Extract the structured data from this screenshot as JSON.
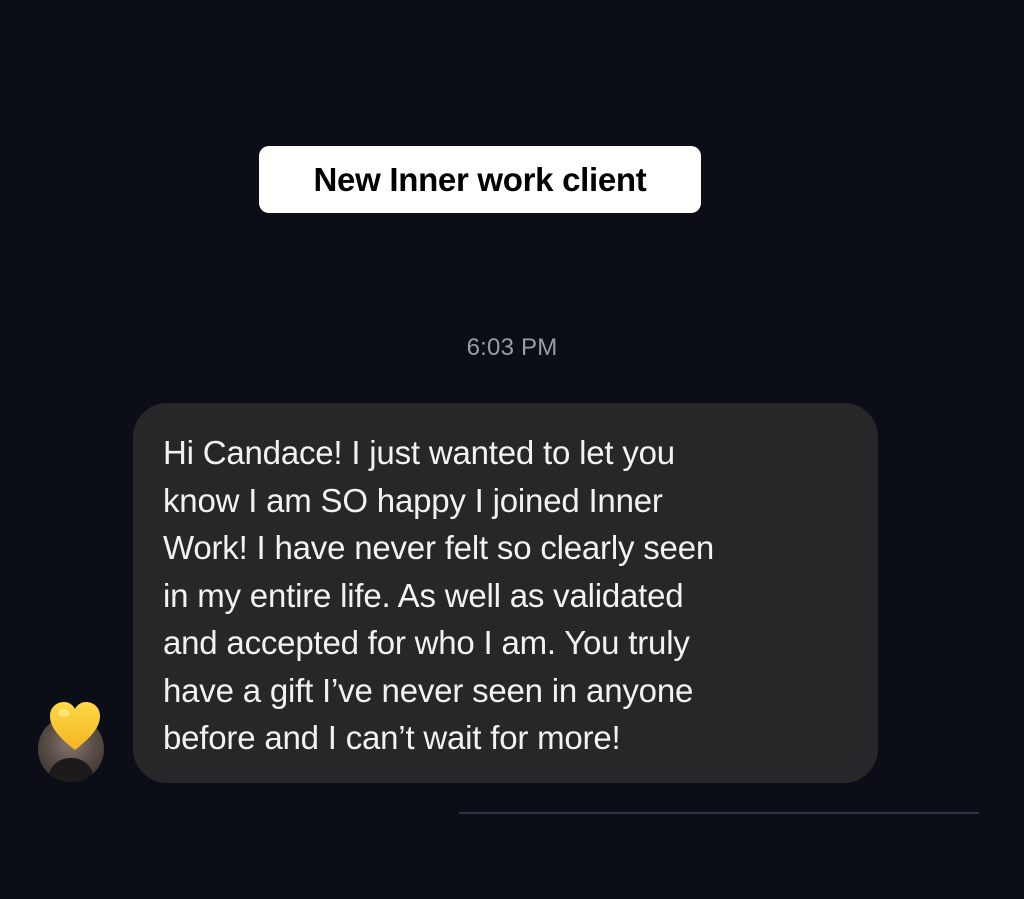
{
  "caption": {
    "text": "New Inner work client"
  },
  "conversation": {
    "timestamp": "6:03 PM",
    "message": {
      "text": "Hi Candace! I just wanted to let you\nknow I am SO happy I joined Inner\nWork! I have never felt so clearly seen\nin my entire life. As well as validated\nand accepted for who I am. You truly\nhave a gift I’ve never seen in anyone\nbefore and I can’t wait for more!"
    },
    "sender": {
      "avatar_icon": "profile-photo",
      "overlay_icon": "yellow-heart-icon"
    }
  },
  "colors": {
    "background": "#0c0e17",
    "bubble": "#262729",
    "heart": "#f7c531"
  }
}
